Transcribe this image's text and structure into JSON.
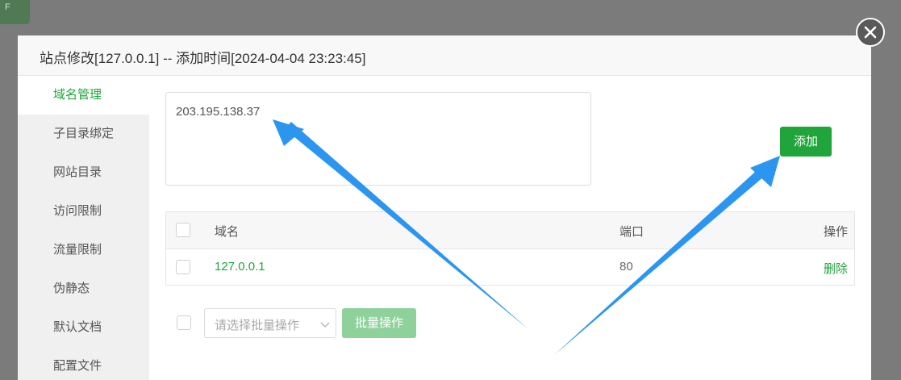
{
  "corner_tag": "F",
  "dialog": {
    "title": "站点修改[127.0.0.1] -- 添加时间[2024-04-04 23:23:45]"
  },
  "sidebar": {
    "items": [
      {
        "label": "域名管理"
      },
      {
        "label": "子目录绑定"
      },
      {
        "label": "网站目录"
      },
      {
        "label": "访问限制"
      },
      {
        "label": "流量限制"
      },
      {
        "label": "伪静态"
      },
      {
        "label": "默认文档"
      },
      {
        "label": "配置文件"
      }
    ],
    "active_index": 0
  },
  "domain_input": {
    "value": "203.195.138.37"
  },
  "add_button": {
    "label": "添加"
  },
  "table": {
    "columns": [
      "域名",
      "端口",
      "操作"
    ],
    "rows": [
      {
        "domain": "127.0.0.1",
        "port": "80",
        "action": "删除"
      }
    ]
  },
  "batch": {
    "select_placeholder": "请选择批量操作",
    "button_label": "批量操作"
  },
  "colors": {
    "accent": "#20a53a",
    "accent_disabled": "#8ed19b",
    "arrow": "#2b95f0",
    "overlay": "#7b7b7b"
  },
  "icons": [
    "close-icon",
    "chevron-down-icon",
    "arrow-annotation"
  ]
}
